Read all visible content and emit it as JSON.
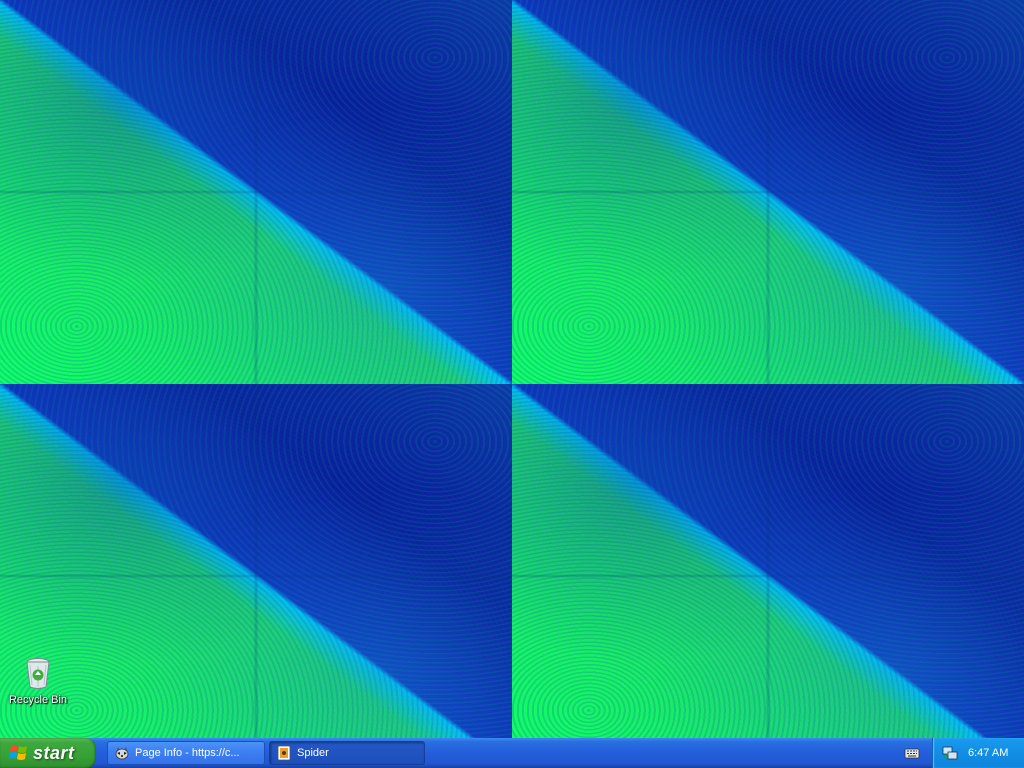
{
  "desktop": {
    "icons": [
      {
        "label": "Recycle Bin",
        "icon": "recycle-bin-icon"
      }
    ]
  },
  "taskbar": {
    "start_label": "start",
    "tasks": [
      {
        "label": "Page Info - https://c...",
        "icon": "raccoon-icon",
        "active": false
      },
      {
        "label": "Spider",
        "icon": "spider-solitaire-icon",
        "active": true
      }
    ],
    "tray": {
      "keyboard_icon": "keyboard-icon",
      "network_icon": "network-icon",
      "clock": "6:47 AM"
    }
  },
  "colors": {
    "wallpaper_green": "#11ff66",
    "wallpaper_blue": "#0a1a9a",
    "taskbar_blue": "#245edb",
    "start_green": "#36a136",
    "tray_blue": "#1290e6"
  }
}
